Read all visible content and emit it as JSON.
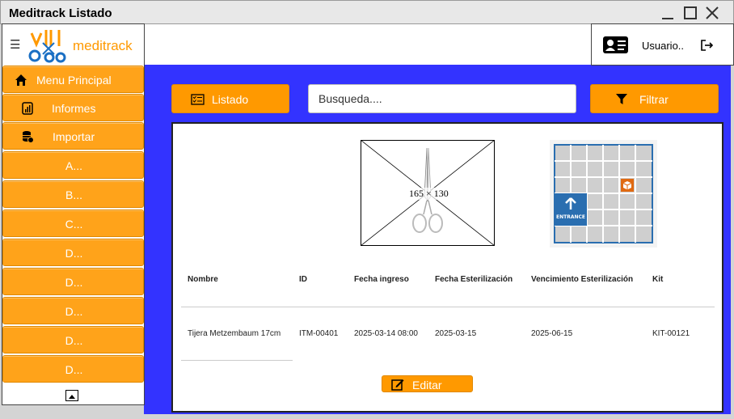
{
  "window": {
    "title": "Meditrack Listado"
  },
  "brand": {
    "logo_text": "meditrack"
  },
  "sidebar": {
    "items": [
      {
        "label": "Menu Principal",
        "icon": "home-icon"
      },
      {
        "label": "Informes",
        "icon": "report-icon"
      },
      {
        "label": "Importar",
        "icon": "database-import-icon"
      },
      {
        "label": "A..."
      },
      {
        "label": "B..."
      },
      {
        "label": "C..."
      },
      {
        "label": "D..."
      },
      {
        "label": "D..."
      },
      {
        "label": "D..."
      },
      {
        "label": "D..."
      },
      {
        "label": "D..."
      }
    ]
  },
  "user": {
    "name": "Usuario..",
    "icon": "id-card-icon",
    "logout_icon": "logout-icon"
  },
  "toolbar": {
    "list_label": "Listado",
    "search_placeholder": "Busqueda....",
    "filter_label": "Filtrar"
  },
  "image": {
    "caption": "165 × 130"
  },
  "map": {
    "entrance_label": "ENTRANCE"
  },
  "table": {
    "headers": [
      "Nombre",
      "ID",
      "Fecha ingreso",
      "Fecha Esterilización",
      "Vencimiento Esterilización",
      "Kit"
    ],
    "rows": [
      [
        "Tijera Metzembaum 17cm",
        "ITM-00401",
        "2025-03-14 08:00",
        "2025-03-15",
        "2025-06-15",
        "KIT-00121"
      ]
    ]
  },
  "actions": {
    "edit_label": "Editar"
  },
  "colors": {
    "accent": "#ff9900",
    "background": "#3333ff",
    "map_blue": "#2a6eb0"
  }
}
